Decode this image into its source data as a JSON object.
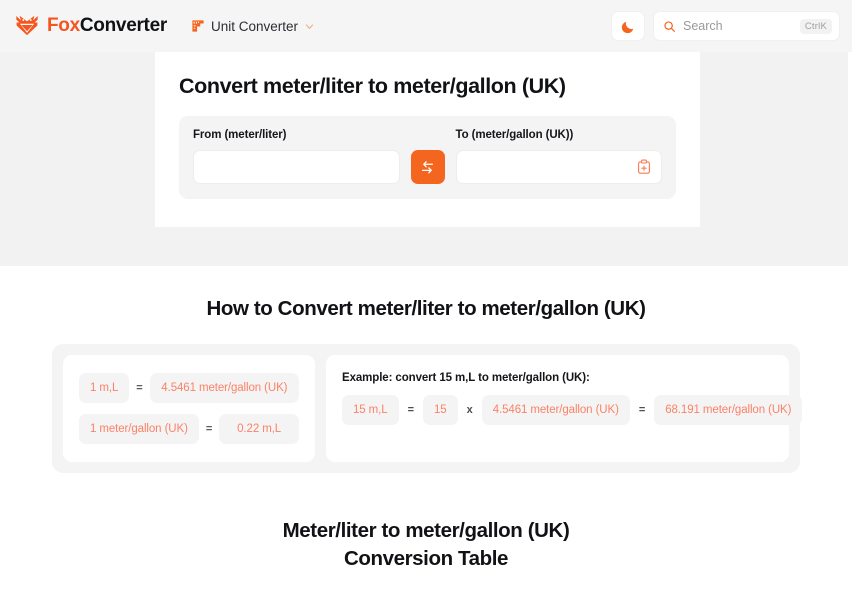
{
  "header": {
    "brand_fox": "Fox",
    "brand_converter": "Converter",
    "logo_icon": "fox-logo-icon",
    "nav_label": "Unit Converter",
    "nav_icon": "ruler-icon",
    "nav_chevron": "chevron-down-icon",
    "theme_icon": "moon-icon",
    "search_icon": "search-icon",
    "search_placeholder": "Search",
    "search_value": "",
    "search_shortcut": "CtrlK",
    "accent_color": "#f4651f",
    "background": "#f5f5f5"
  },
  "converter": {
    "title": "Convert meter/liter to meter/gallon (UK)",
    "from_label": "From (meter/liter)",
    "from_value": "",
    "to_label": "To (meter/gallon (UK))",
    "to_value": "",
    "swap_icon": "swap-arrows-icon",
    "paste_icon": "clipboard-plus-icon"
  },
  "howto": {
    "title": "How to Convert meter/liter to meter/gallon (UK)",
    "formulas": [
      {
        "left": "1 m,L",
        "op": "=",
        "right": "4.5461 meter/gallon (UK)"
      },
      {
        "left": "1 meter/gallon (UK)",
        "op": "=",
        "right": "0.22 m,L"
      }
    ],
    "example_label": "Example: convert 15 m,L to meter/gallon (UK):",
    "example": {
      "value": "15 m,L",
      "eq1": "=",
      "factor_a": "15",
      "times": "x",
      "factor_b": "4.5461 meter/gallon (UK)",
      "eq2": "=",
      "result": "68.191 meter/gallon (UK)"
    },
    "chip_text_color": "#fb8267",
    "chip_bg": "#f4f4f5"
  },
  "table_section": {
    "title_line1": "Meter/liter to meter/gallon (UK)",
    "title_line2": "Conversion Table"
  }
}
